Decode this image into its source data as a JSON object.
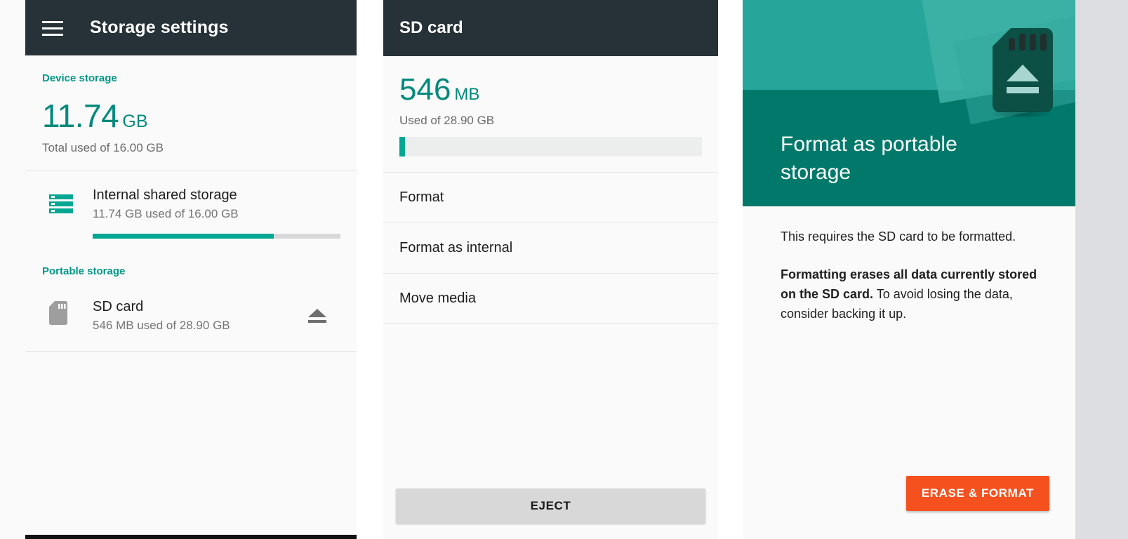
{
  "colors": {
    "appbar": "#263238",
    "teal_accent": "#009688",
    "teal_number": "#00897b",
    "progress_fill": "#00a792",
    "progress_track": "#d8d8d8",
    "hero_top": "#26a69a",
    "hero_bottom": "#00796b",
    "sd_card_art": "#0c4f45",
    "danger_button": "#f4511e",
    "panel_bg": "#fafafa",
    "gutter": "#dcdee1"
  },
  "panel_storage_settings": {
    "appbar": {
      "menu_icon": "hamburger-menu-icon",
      "title": "Storage settings"
    },
    "device_section": {
      "label": "Device storage",
      "total_value": "11.74",
      "total_unit": "GB",
      "total_caption": "Total used of 16.00 GB"
    },
    "internal_row": {
      "icon": "internal-storage-icon",
      "title": "Internal shared storage",
      "subtitle": "11.74 GB used of 16.00 GB",
      "progress_percent": 73
    },
    "portable_section": {
      "label": "Portable storage"
    },
    "sd_row": {
      "icon": "sd-card-icon",
      "title": "SD card",
      "subtitle": "546 MB used of 28.90 GB",
      "action_icon": "eject-icon"
    }
  },
  "panel_sd_card": {
    "appbar": {
      "title": "SD card"
    },
    "stats": {
      "used_value": "546",
      "used_unit": "MB",
      "caption": "Used of 28.90 GB",
      "progress_percent": 1.8
    },
    "menu_items": [
      {
        "label": "Format"
      },
      {
        "label": "Format as internal"
      },
      {
        "label": "Move media"
      }
    ],
    "eject_button": "EJECT"
  },
  "panel_format_portable": {
    "hero": {
      "title": "Format as portable storage",
      "art_icon": "sd-card-eject-illustration"
    },
    "paragraph_one": "This requires the SD card to be formatted.",
    "paragraph_two_bold": "Formatting erases all data currently stored on the SD card.",
    "paragraph_two_rest": " To avoid losing the data, consider backing it up.",
    "erase_button": "ERASE & FORMAT"
  }
}
